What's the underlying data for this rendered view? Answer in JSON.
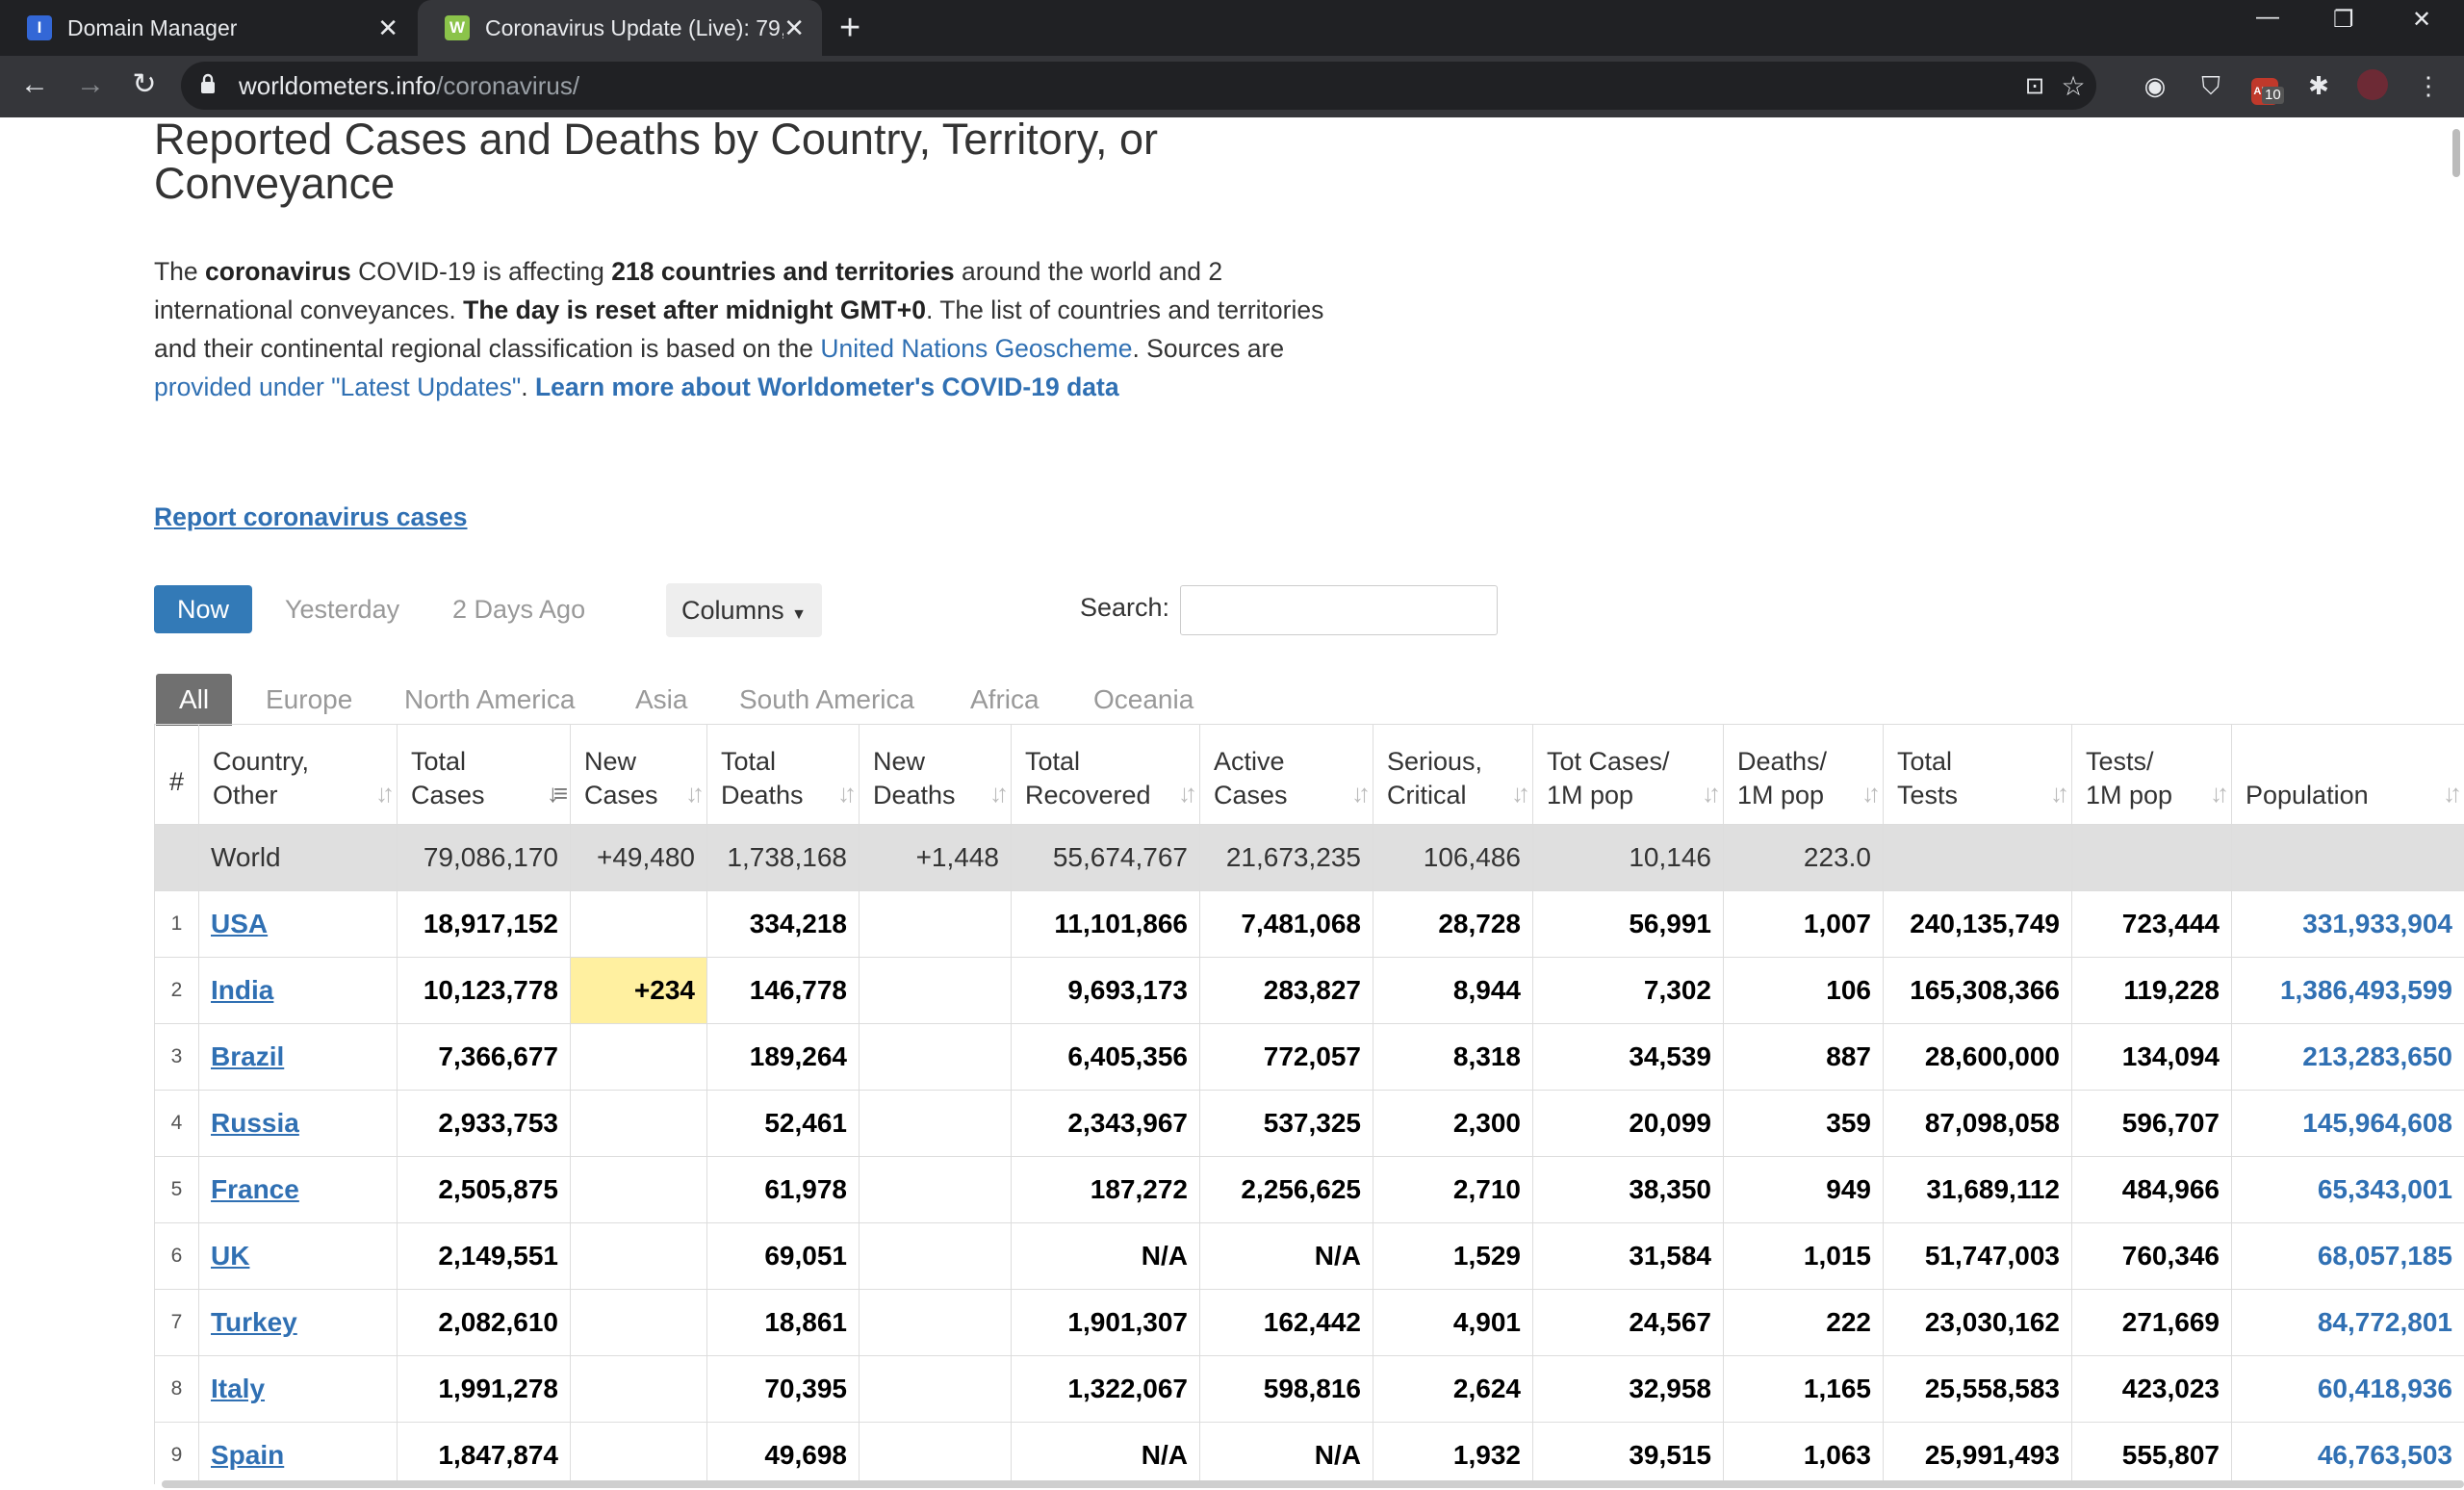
{
  "browser": {
    "tabs": [
      {
        "title": "Domain Manager",
        "favicon_color": "#3367d6",
        "favicon_glyph": "I"
      },
      {
        "title": "Coronavirus Update (Live): 79,",
        "favicon_color": "#8bc34a",
        "favicon_glyph": "W"
      }
    ],
    "url_host": "worldometers.info",
    "url_path": "/coronavirus/",
    "extension_badge": "10",
    "extension_label": "ABP"
  },
  "page": {
    "heading": "Reported Cases and Deaths by Country, Territory, or Conveyance",
    "intro": {
      "t1": "The ",
      "b1": "coronavirus",
      "t2": " COVID-19 is affecting ",
      "b2": "218 countries and territories",
      "t3": " around the world and 2 international conveyances. ",
      "b3": "The day is reset after midnight GMT+0",
      "t4": ". The list of countries and territories and their continental regional classification is based on the ",
      "link1": "United Nations Geoscheme",
      "t5": ". Sources are ",
      "link2": "provided under \"Latest Updates\"",
      "t6": ". ",
      "link3": "Learn more about Worldometer's COVID-19 data"
    },
    "report_link": "Report coronavirus cases",
    "day_tabs": [
      "Now",
      "Yesterday",
      "2 Days Ago"
    ],
    "columns_button": "Columns",
    "search_label": "Search:",
    "search_value": "",
    "region_tabs": [
      "All",
      "Europe",
      "North America",
      "Asia",
      "South America",
      "Africa",
      "Oceania"
    ]
  },
  "table": {
    "headers": [
      [
        "#"
      ],
      [
        "Country,",
        "Other"
      ],
      [
        "Total",
        "Cases"
      ],
      [
        "New",
        "Cases"
      ],
      [
        "Total",
        "Deaths"
      ],
      [
        "New",
        "Deaths"
      ],
      [
        "Total",
        "Recovered"
      ],
      [
        "Active",
        "Cases"
      ],
      [
        "Serious,",
        "Critical"
      ],
      [
        "Tot Cases/",
        "1M pop"
      ],
      [
        "Deaths/",
        "1M pop"
      ],
      [
        "Total",
        "Tests"
      ],
      [
        "Tests/",
        "1M pop"
      ],
      [
        "Population"
      ]
    ],
    "world": {
      "country": "World",
      "total_cases": "79,086,170",
      "new_cases": "+49,480",
      "total_deaths": "1,738,168",
      "new_deaths": "+1,448",
      "total_recovered": "55,674,767",
      "active_cases": "21,673,235",
      "serious": "106,486",
      "cases_per_m": "10,146",
      "deaths_per_m": "223.0",
      "total_tests": "",
      "tests_per_m": "",
      "population": ""
    },
    "rows": [
      {
        "rank": "1",
        "country": "USA",
        "total_cases": "18,917,152",
        "new_cases": "",
        "total_deaths": "334,218",
        "new_deaths": "",
        "total_recovered": "11,101,866",
        "active_cases": "7,481,068",
        "serious": "28,728",
        "cases_per_m": "56,991",
        "deaths_per_m": "1,007",
        "total_tests": "240,135,749",
        "tests_per_m": "723,444",
        "population": "331,933,904"
      },
      {
        "rank": "2",
        "country": "India",
        "total_cases": "10,123,778",
        "new_cases": "+234",
        "total_deaths": "146,778",
        "new_deaths": "",
        "total_recovered": "9,693,173",
        "active_cases": "283,827",
        "serious": "8,944",
        "cases_per_m": "7,302",
        "deaths_per_m": "106",
        "total_tests": "165,308,366",
        "tests_per_m": "119,228",
        "population": "1,386,493,599"
      },
      {
        "rank": "3",
        "country": "Brazil",
        "total_cases": "7,366,677",
        "new_cases": "",
        "total_deaths": "189,264",
        "new_deaths": "",
        "total_recovered": "6,405,356",
        "active_cases": "772,057",
        "serious": "8,318",
        "cases_per_m": "34,539",
        "deaths_per_m": "887",
        "total_tests": "28,600,000",
        "tests_per_m": "134,094",
        "population": "213,283,650"
      },
      {
        "rank": "4",
        "country": "Russia",
        "total_cases": "2,933,753",
        "new_cases": "",
        "total_deaths": "52,461",
        "new_deaths": "",
        "total_recovered": "2,343,967",
        "active_cases": "537,325",
        "serious": "2,300",
        "cases_per_m": "20,099",
        "deaths_per_m": "359",
        "total_tests": "87,098,058",
        "tests_per_m": "596,707",
        "population": "145,964,608"
      },
      {
        "rank": "5",
        "country": "France",
        "total_cases": "2,505,875",
        "new_cases": "",
        "total_deaths": "61,978",
        "new_deaths": "",
        "total_recovered": "187,272",
        "active_cases": "2,256,625",
        "serious": "2,710",
        "cases_per_m": "38,350",
        "deaths_per_m": "949",
        "total_tests": "31,689,112",
        "tests_per_m": "484,966",
        "population": "65,343,001"
      },
      {
        "rank": "6",
        "country": "UK",
        "total_cases": "2,149,551",
        "new_cases": "",
        "total_deaths": "69,051",
        "new_deaths": "",
        "total_recovered": "N/A",
        "active_cases": "N/A",
        "serious": "1,529",
        "cases_per_m": "31,584",
        "deaths_per_m": "1,015",
        "total_tests": "51,747,003",
        "tests_per_m": "760,346",
        "population": "68,057,185"
      },
      {
        "rank": "7",
        "country": "Turkey",
        "total_cases": "2,082,610",
        "new_cases": "",
        "total_deaths": "18,861",
        "new_deaths": "",
        "total_recovered": "1,901,307",
        "active_cases": "162,442",
        "serious": "4,901",
        "cases_per_m": "24,567",
        "deaths_per_m": "222",
        "total_tests": "23,030,162",
        "tests_per_m": "271,669",
        "population": "84,772,801"
      },
      {
        "rank": "8",
        "country": "Italy",
        "total_cases": "1,991,278",
        "new_cases": "",
        "total_deaths": "70,395",
        "new_deaths": "",
        "total_recovered": "1,322,067",
        "active_cases": "598,816",
        "serious": "2,624",
        "cases_per_m": "32,958",
        "deaths_per_m": "1,165",
        "total_tests": "25,558,583",
        "tests_per_m": "423,023",
        "population": "60,418,936"
      },
      {
        "rank": "9",
        "country": "Spain",
        "total_cases": "1,847,874",
        "new_cases": "",
        "total_deaths": "49,698",
        "new_deaths": "",
        "total_recovered": "N/A",
        "active_cases": "N/A",
        "serious": "1,932",
        "cases_per_m": "39,515",
        "deaths_per_m": "1,063",
        "total_tests": "25,991,493",
        "tests_per_m": "555,807",
        "population": "46,763,503"
      }
    ]
  },
  "colors": {
    "link": "#3070b3",
    "active_button": "#337ab7",
    "new_cases_highlight": "#fff0a0",
    "world_row": "#dfdfdf",
    "region_tab_active": "#707070"
  }
}
